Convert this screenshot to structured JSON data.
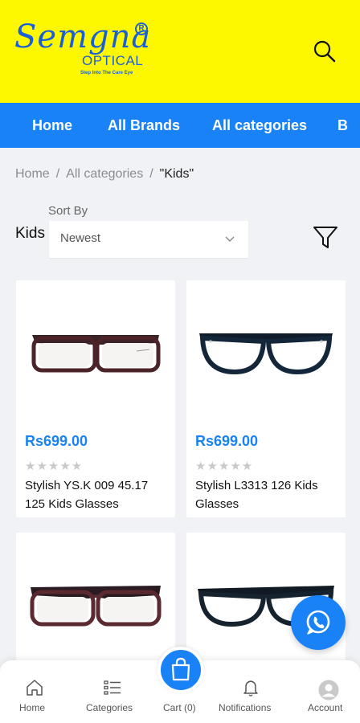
{
  "brand": {
    "name": "Semgna",
    "registered": "R",
    "sub": "OPTICAL",
    "tagline": "Step Into The Care Eye",
    "logo_color": "#1a5fd6",
    "header_bg": "#fdf800",
    "accent": "#1a82f7"
  },
  "nav": {
    "items": [
      "Home",
      "All Brands",
      "All categories",
      "B"
    ]
  },
  "breadcrumb": {
    "home": "Home",
    "sep": "/",
    "categories": "All categories",
    "current": "\"Kids\""
  },
  "listing": {
    "title": "Kids",
    "sort_label": "Sort By",
    "sort_value": "Newest"
  },
  "products": [
    {
      "price": "Rs699.00",
      "rating": 0,
      "stars": "★★★★★",
      "name": "Stylish YS.K 009 45.17 125 Kids Glasses",
      "frame": "maroon"
    },
    {
      "price": "Rs699.00",
      "rating": 0,
      "stars": "★★★★★",
      "name": "Stylish L3313 126 Kids Glasses",
      "frame": "navy"
    },
    {
      "price": "",
      "rating": 0,
      "stars": "",
      "name": "",
      "frame": "maroon"
    },
    {
      "price": "",
      "rating": 0,
      "stars": "",
      "name": "",
      "frame": "navy"
    }
  ],
  "bottom_nav": {
    "home": "Home",
    "categories": "Categories",
    "cart": "Cart (0)",
    "notifications": "Notifications",
    "account": "Account"
  },
  "icons": [
    "search-icon",
    "filter-icon",
    "chevron-down-icon",
    "whatsapp-icon",
    "home-icon",
    "list-icon",
    "shopping-bag-icon",
    "bell-icon",
    "user-avatar-icon"
  ]
}
